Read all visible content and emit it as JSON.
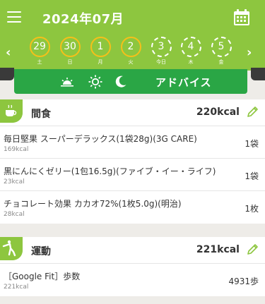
{
  "header": {
    "title": "2024年07月"
  },
  "week": [
    {
      "num": "29",
      "wd": "土",
      "style": "ring"
    },
    {
      "num": "30",
      "wd": "日",
      "style": "ring"
    },
    {
      "num": "1",
      "wd": "月",
      "style": "ring"
    },
    {
      "num": "2",
      "wd": "火",
      "style": "ring"
    },
    {
      "num": "3",
      "wd": "今日",
      "style": "plain"
    },
    {
      "num": "4",
      "wd": "木",
      "style": "plain"
    },
    {
      "num": "5",
      "wd": "金",
      "style": "plain"
    }
  ],
  "advice": {
    "label": "アドバイス"
  },
  "snack": {
    "title": "間食",
    "kcal": "220kcal",
    "items": [
      {
        "name": "毎日堅果 スーパーデラックス(1袋28g)(3G CARE)",
        "kcal": "169kcal",
        "qty": "1袋"
      },
      {
        "name": "黒にんにくゼリー(1包16.5g)(ファイブ・イー・ライフ)",
        "kcal": "23kcal",
        "qty": "1袋"
      },
      {
        "name": "チョコレート効果 カカオ72%(1枚5.0g)(明治)",
        "kcal": "28kcal",
        "qty": "1枚"
      }
    ]
  },
  "exercise": {
    "title": "運動",
    "kcal": "221kcal",
    "items": [
      {
        "name": "［Google Fit］歩数",
        "kcal": "221kcal",
        "qty": "4931歩"
      }
    ]
  },
  "colors": {
    "header_green": "#8dc63f",
    "advice_green": "#2aa645",
    "ring_yellow": "#f5c01a",
    "background": "#eeece8"
  },
  "icons": [
    "menu-icon",
    "calendar-icon",
    "sunrise-icon",
    "sun-icon",
    "moon-icon",
    "cup-icon",
    "exercise-icon",
    "pencil-icon"
  ]
}
